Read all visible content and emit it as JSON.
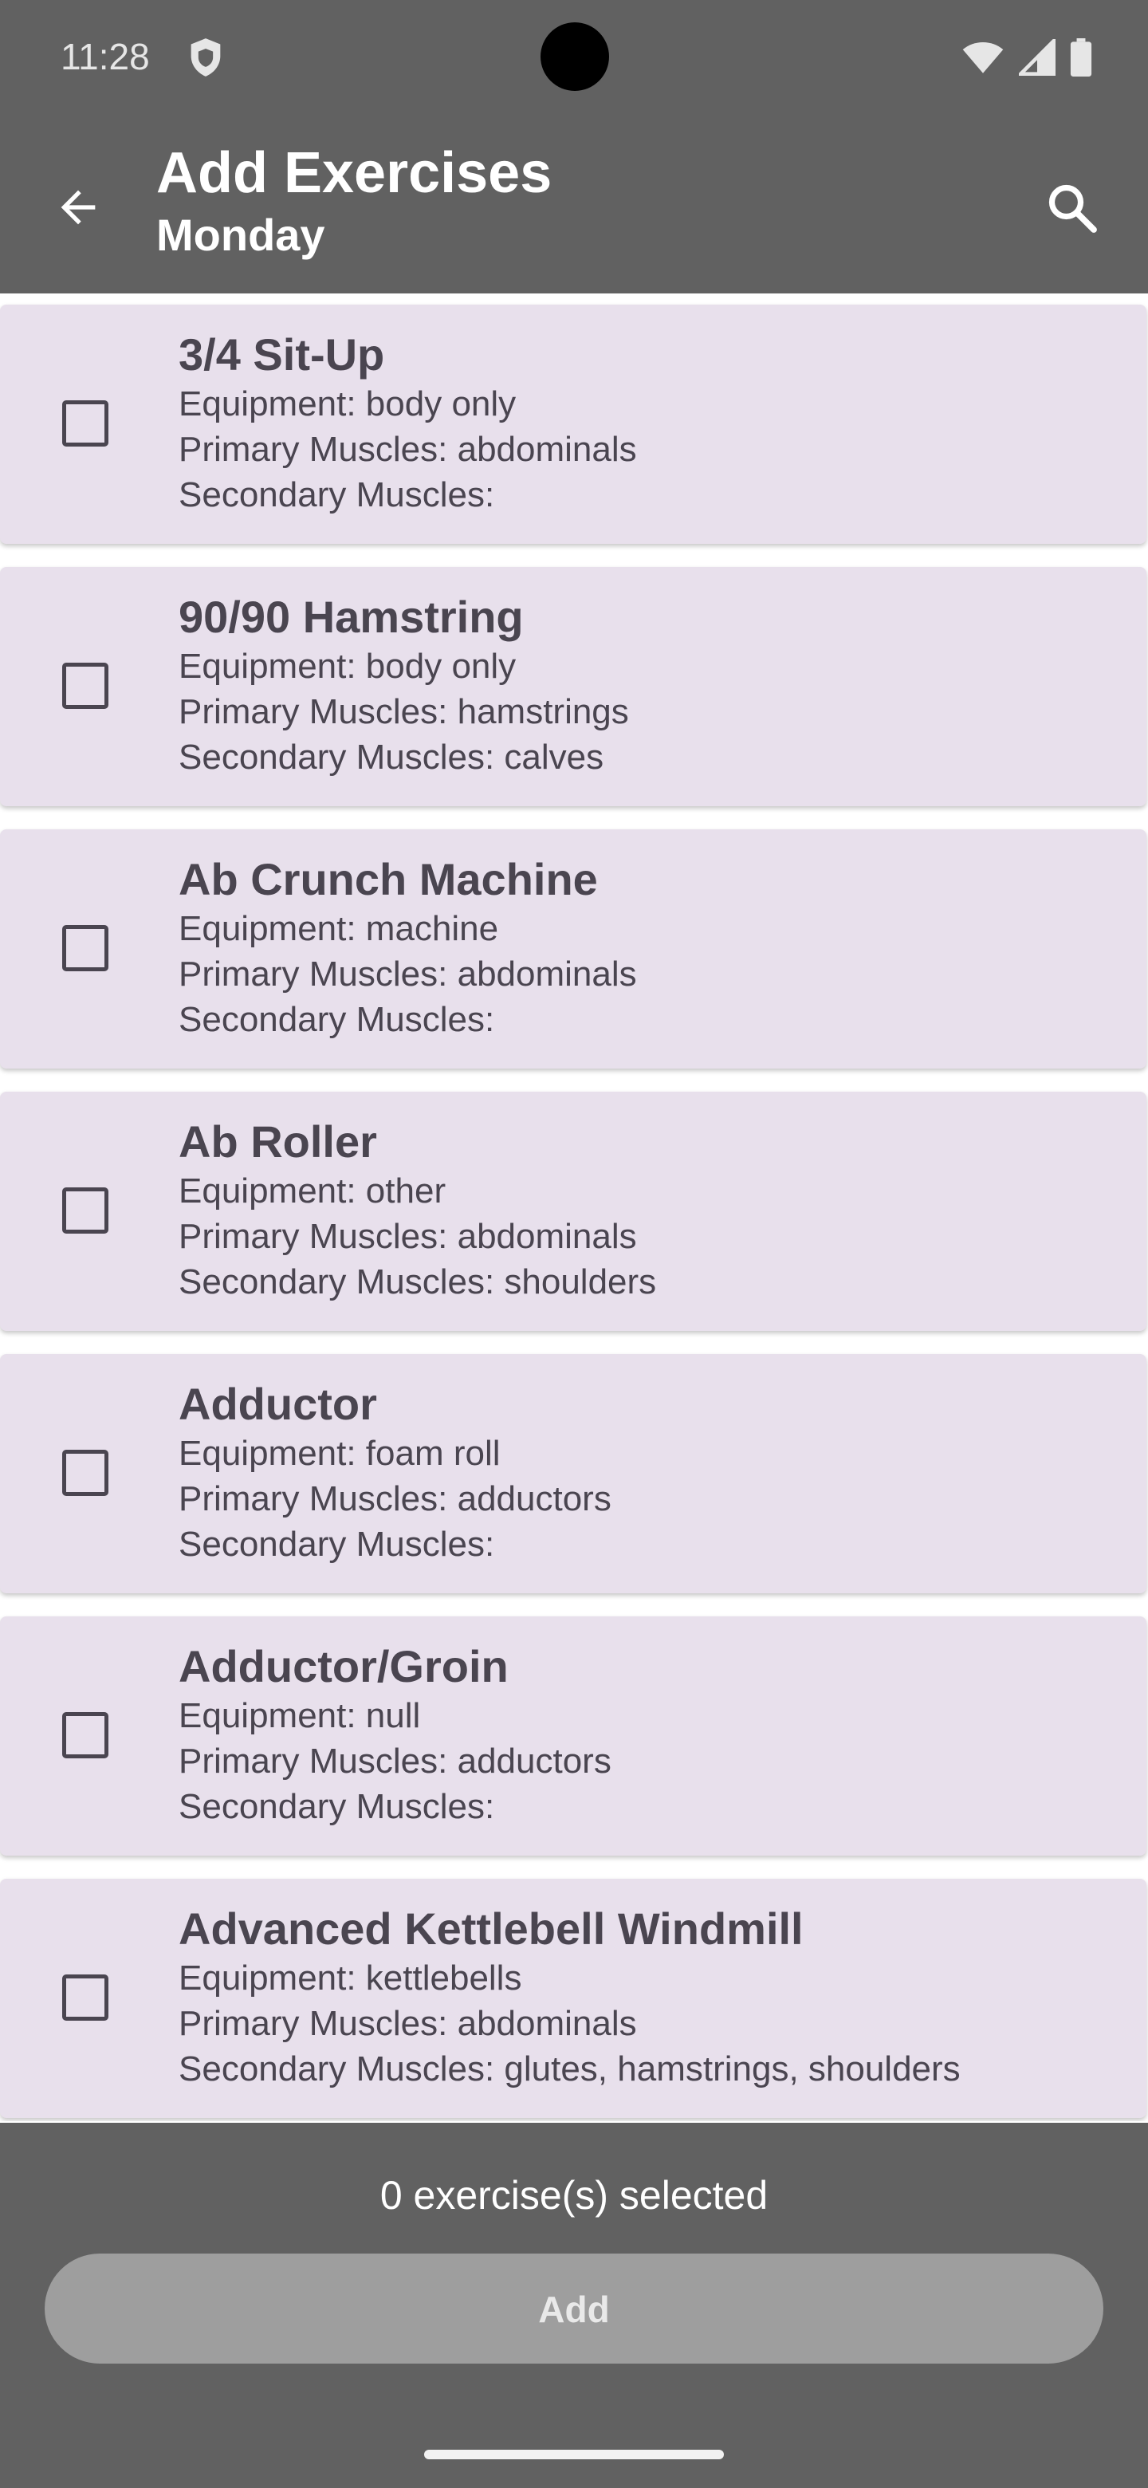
{
  "status_bar": {
    "time": "11:28"
  },
  "app_bar": {
    "title": "Add Exercises",
    "subtitle": "Monday"
  },
  "exercises": [
    {
      "name": "3/4 Sit-Up",
      "equipment": "Equipment: body only",
      "primary": "Primary Muscles: abdominals",
      "secondary": "Secondary Muscles:",
      "checked": false
    },
    {
      "name": "90/90 Hamstring",
      "equipment": "Equipment: body only",
      "primary": "Primary Muscles: hamstrings",
      "secondary": "Secondary Muscles: calves",
      "checked": false
    },
    {
      "name": "Ab Crunch Machine",
      "equipment": "Equipment: machine",
      "primary": "Primary Muscles: abdominals",
      "secondary": "Secondary Muscles:",
      "checked": false
    },
    {
      "name": "Ab Roller",
      "equipment": "Equipment: other",
      "primary": "Primary Muscles: abdominals",
      "secondary": "Secondary Muscles: shoulders",
      "checked": false
    },
    {
      "name": "Adductor",
      "equipment": "Equipment: foam roll",
      "primary": "Primary Muscles: adductors",
      "secondary": "Secondary Muscles:",
      "checked": false
    },
    {
      "name": "Adductor/Groin",
      "equipment": "Equipment: null",
      "primary": "Primary Muscles: adductors",
      "secondary": "Secondary Muscles:",
      "checked": false
    },
    {
      "name": "Advanced Kettlebell Windmill",
      "equipment": "Equipment: kettlebells",
      "primary": "Primary Muscles: abdominals",
      "secondary": "Secondary Muscles: glutes, hamstrings, shoulders",
      "checked": false
    }
  ],
  "footer": {
    "selected_text": "0 exercise(s) selected",
    "add_label": "Add"
  },
  "colors": {
    "bar": "#616161",
    "card": "#e8e0ec",
    "text": "#4a4550",
    "button_disabled": "#9e9e9e"
  },
  "icons": {
    "back": "arrow-left-icon",
    "search": "search-icon",
    "shield": "shield-icon",
    "wifi": "wifi-icon",
    "signal": "signal-icon",
    "battery": "battery-icon"
  }
}
